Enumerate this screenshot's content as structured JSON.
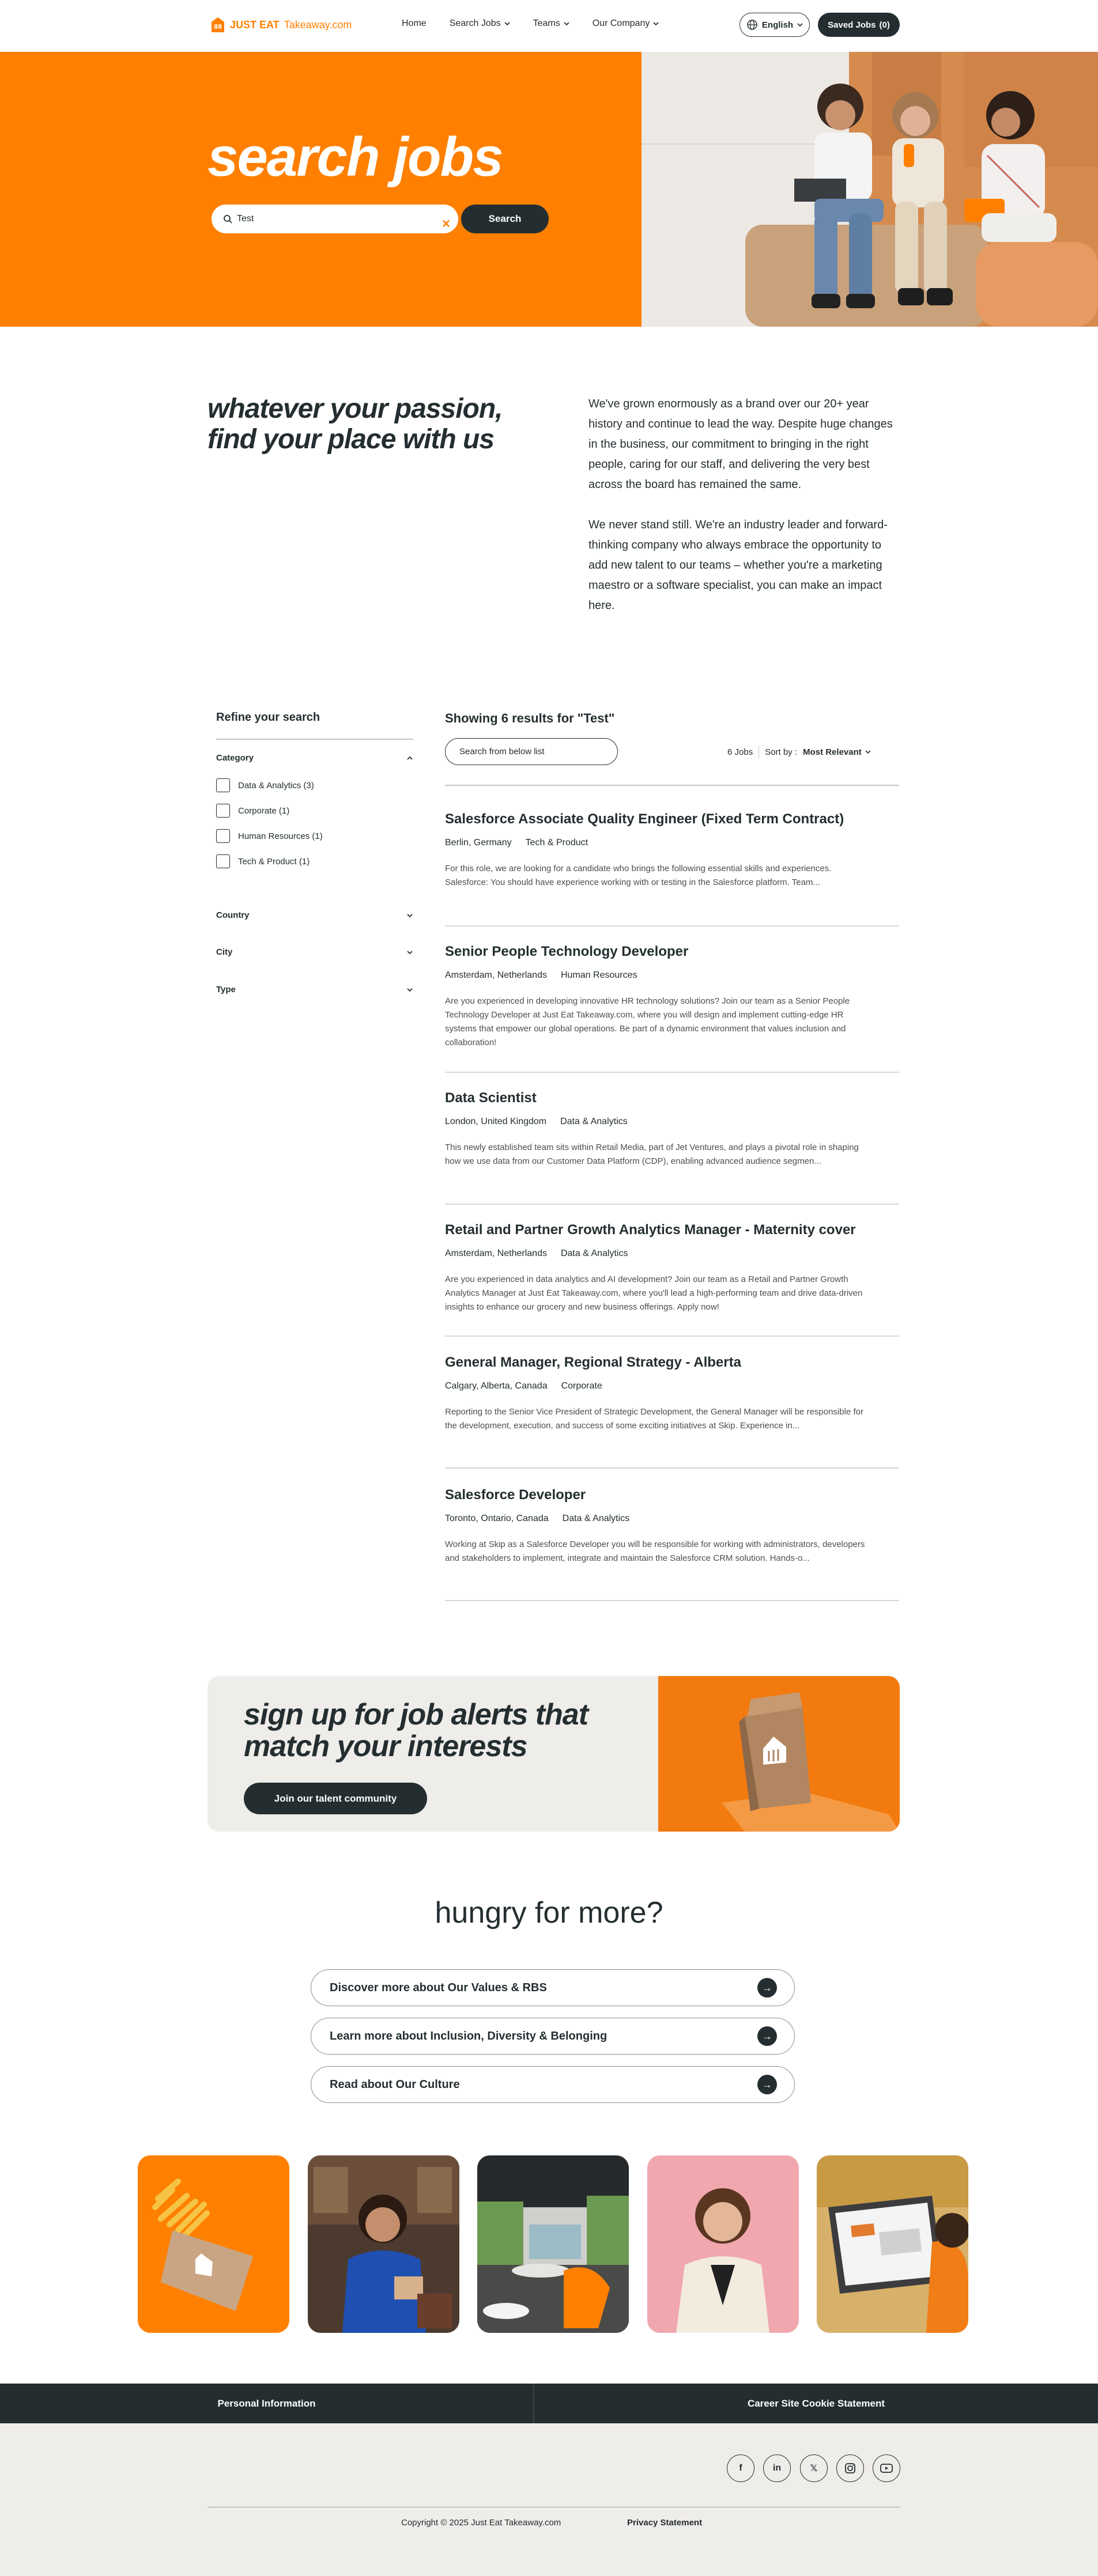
{
  "brand": {
    "name_bold": "JUST EAT",
    "name_light": "Takeaway.com",
    "accent": "#ff8000",
    "dark": "#242e30"
  },
  "nav": {
    "items": [
      "Home",
      "Search Jobs",
      "Teams",
      "Our Company"
    ]
  },
  "header": {
    "language": "English",
    "saved_jobs_label": "Saved Jobs",
    "saved_jobs_count": "(0)"
  },
  "hero": {
    "title": "search jobs",
    "search_value": "Test",
    "search_button": "Search"
  },
  "intro": {
    "heading": "whatever your passion, find your place with us",
    "p1": "We've grown enormously as a brand over our 20+ year history and continue to lead the way. Despite huge changes in the business, our commitment to bringing in the right people, caring for our staff, and delivering the very best across the board has remained the same.",
    "p2": "We never stand still. We're an industry leader and forward-thinking company who always embrace the opportunity to add new talent to our teams – whether you're a marketing maestro or a software specialist, you can make an impact here."
  },
  "filters": {
    "title": "Refine your search",
    "category_label": "Category",
    "category_options": [
      "Data & Analytics (3)",
      "Corporate (1)",
      "Human Resources (1)",
      "Tech & Product (1)"
    ],
    "country_label": "Country",
    "city_label": "City",
    "type_label": "Type"
  },
  "results": {
    "title": "Showing 6 results for \"Test\"",
    "search_placeholder": "Search from below list",
    "count": "6 Jobs",
    "sort_label": "Sort by :",
    "sort_value": "Most Relevant",
    "jobs": [
      {
        "title": "Salesforce Associate Quality Engineer (Fixed Term Contract)",
        "location": "Berlin, Germany",
        "category": "Tech & Product",
        "description": "For this role, we are looking for a candidate who brings the following essential skills and experiences. Salesforce: You should have experience working with or testing in the Salesforce platform. Team..."
      },
      {
        "title": "Senior People Technology Developer",
        "location": "Amsterdam, Netherlands",
        "category": "Human Resources",
        "description": "Are you experienced in developing innovative HR technology solutions? Join our team as a Senior People Technology Developer at Just Eat Takeaway.com, where you will design and implement cutting-edge HR systems that empower our global operations. Be part of a dynamic environment that values inclusion and collaboration!"
      },
      {
        "title": "Data Scientist",
        "location": "London, United Kingdom",
        "category": "Data & Analytics",
        "description": "This newly established team sits within Retail Media, part of Jet Ventures, and plays a pivotal role in shaping how we use data from our Customer Data Platform (CDP), enabling advanced audience segmen..."
      },
      {
        "title": "Retail and Partner Growth Analytics Manager - Maternity cover",
        "location": "Amsterdam, Netherlands",
        "category": "Data & Analytics",
        "description": "Are you experienced in data analytics and AI development? Join our team as a Retail and Partner Growth Analytics Manager at Just Eat Takeaway.com, where you'll lead a high-performing team and drive data-driven insights to enhance our grocery and new business offerings. Apply now!"
      },
      {
        "title": "General Manager, Regional Strategy - Alberta",
        "location": "Calgary, Alberta, Canada",
        "category": "Corporate",
        "description": "Reporting to the Senior Vice President of Strategic Development, the General Manager will be responsible for the development, execution, and success of some exciting initiatives at Skip. Experience in..."
      },
      {
        "title": "Salesforce Developer",
        "location": "Toronto, Ontario, Canada",
        "category": "Data & Analytics",
        "description": "Working at Skip as a Salesforce Developer you will be responsible for working with administrators, developers and stakeholders to implement, integrate and maintain the Salesforce CRM solution. Hands-o..."
      }
    ]
  },
  "signup": {
    "title": "sign up for job alerts that match your interests",
    "button": "Join our talent community"
  },
  "hungry": {
    "title": "hungry for more?",
    "links": [
      "Discover more about Our Values & RBS",
      "Learn more about Inclusion, Diversity & Belonging",
      "Read about Our Culture"
    ]
  },
  "footer": {
    "personal_info": "Personal Information",
    "cookie_statement": "Career Site Cookie Statement",
    "social": [
      "facebook-icon",
      "linkedin-icon",
      "x-icon",
      "instagram-icon",
      "youtube-icon"
    ],
    "copyright": "Copyright © 2025 Just Eat Takeaway.com",
    "privacy": "Privacy Statement"
  }
}
